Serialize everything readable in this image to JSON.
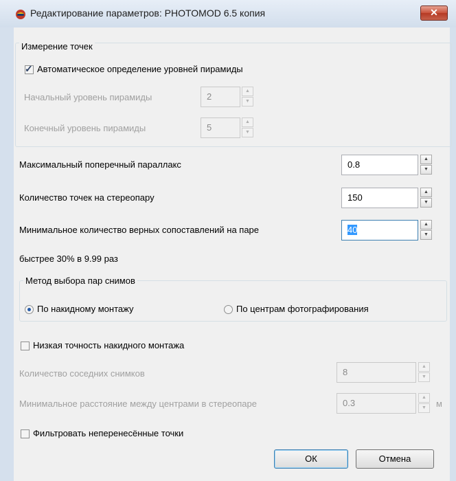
{
  "window": {
    "title": "Редактирование параметров: PHOTOMOD 6.5 копия"
  },
  "point_measurement": {
    "group_title": "Измерение точек",
    "auto_pyramid_label": "Автоматическое определение уровней пирамиды",
    "auto_pyramid_checked": true,
    "start_level_label": "Начальный уровень пирамиды",
    "start_level_value": "2",
    "end_level_label": "Конечный уровень пирамиды",
    "end_level_value": "5"
  },
  "max_parallax": {
    "label": "Максимальный поперечный параллакс",
    "value": "0.8"
  },
  "points_per_pair": {
    "label": "Количество точек на стереопару",
    "value": "150"
  },
  "min_matches": {
    "label": "Минимальное количество верных сопоставлений на паре",
    "value": "40"
  },
  "speed_text": "быстрее 30% в 9.99 раз",
  "pair_method": {
    "group_title": "Метод выбора пар снимов",
    "option_overlay": "По накидному монтажу",
    "option_centers": "По центрам фотографирования",
    "selected": "overlay"
  },
  "low_accuracy": {
    "label": "Низкая точность накидного монтажа",
    "checked": false
  },
  "neighbor_count": {
    "label": "Количество соседних снимков",
    "value": "8"
  },
  "min_distance": {
    "label": "Минимальное расстояние между центрами в стереопаре",
    "value": "0.3",
    "unit": "м"
  },
  "filter_points": {
    "label": "Фильтровать неперенесённые точки",
    "checked": false
  },
  "buttons": {
    "ok": "ОК",
    "cancel": "Отмена"
  },
  "icons": {
    "app": "photomod-app-icon",
    "close": "close-icon",
    "spin_up": "spin-up-icon",
    "spin_down": "spin-down-icon"
  },
  "colors": {
    "titlebar": "#d2deec",
    "selection": "#3399ff",
    "close": "#c8513b"
  }
}
